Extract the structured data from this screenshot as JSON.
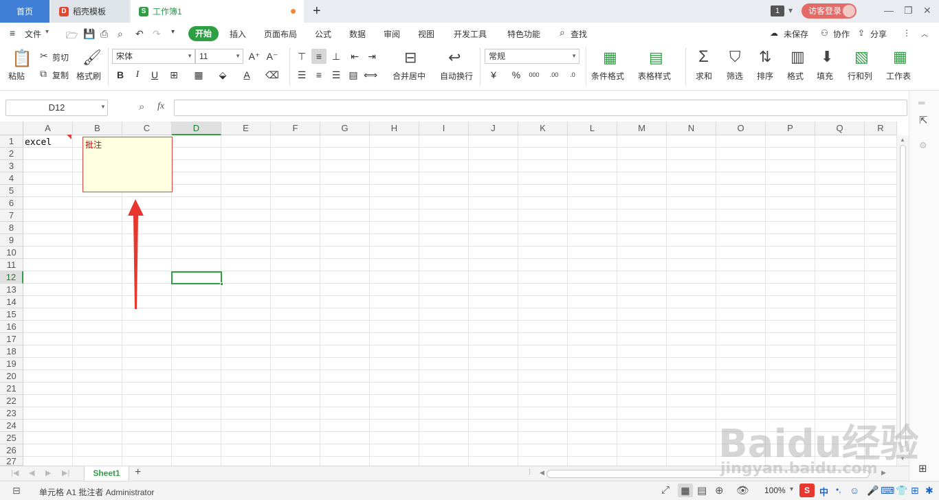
{
  "tabs": {
    "home": "首页",
    "template": "稻壳模板",
    "workbook": "工作簿1",
    "new_tab_icon": "plus-icon",
    "window_count": "1",
    "login": "访客登录"
  },
  "menu": {
    "file": "文件",
    "items": [
      "开始",
      "插入",
      "页面布局",
      "公式",
      "数据",
      "审阅",
      "视图",
      "开发工具",
      "特色功能"
    ],
    "search": "查找",
    "unsaved": "未保存",
    "collab": "协作",
    "share": "分享"
  },
  "ribbon": {
    "paste": "粘贴",
    "cut": "剪切",
    "copy": "复制",
    "format_painter": "格式刷",
    "font_name": "宋体",
    "font_size": "11",
    "merge_center": "合并居中",
    "auto_wrap": "自动换行",
    "number_format": "常规",
    "cond_format": "条件格式",
    "table_style": "表格样式",
    "sum": "求和",
    "filter": "筛选",
    "sort": "排序",
    "format": "格式",
    "fill": "填充",
    "row_col": "行和列",
    "worksheet": "工作表"
  },
  "formula_bar": {
    "name_box": "D12",
    "fx": "fx",
    "value": ""
  },
  "grid": {
    "columns": [
      "A",
      "B",
      "C",
      "D",
      "E",
      "F",
      "G",
      "H",
      "I",
      "J",
      "K",
      "L",
      "M",
      "N",
      "O",
      "P",
      "Q",
      "R"
    ],
    "rows": [
      "1",
      "2",
      "3",
      "4",
      "5",
      "6",
      "7",
      "8",
      "9",
      "10",
      "11",
      "12",
      "13",
      "14",
      "15",
      "16",
      "17",
      "18",
      "19",
      "20",
      "21",
      "22",
      "23",
      "24",
      "25",
      "26",
      "27"
    ],
    "selected_column": "D",
    "selected_row": "12",
    "cell_a1": "excel",
    "comment_text": "批注"
  },
  "sheets": {
    "active": "Sheet1",
    "add_icon": "plus-icon"
  },
  "status": {
    "text": "单元格 A1 批注者 Administrator",
    "zoom": "100%",
    "ime_lang": "中"
  },
  "watermark": {
    "brand": "Baidu经验",
    "url": "jingyan.baidu.com"
  },
  "colors": {
    "accent_green": "#2ea043",
    "home_tab_blue": "#3f7fd6",
    "comment_border": "#e04040",
    "arrow_red": "#e8372f",
    "login_pill": "#e46a67"
  }
}
